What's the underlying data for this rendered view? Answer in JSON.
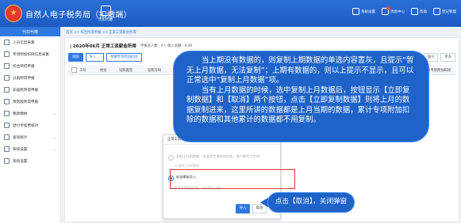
{
  "app": {
    "title": "自然人电子税务局（扣缴端）",
    "emblem": "★",
    "nav_label": "代扣代缴",
    "top_right": [
      "系统设置",
      "消息中心",
      "帮助",
      "登记管理"
    ]
  },
  "sidebar": {
    "header": "代扣代缴",
    "items": [
      {
        "label": "人员信息采集",
        "chevron": ""
      },
      {
        "label": "专项附加扣除信息采集",
        "chevron": ""
      },
      {
        "label": "综合所得申报",
        "chevron": ""
      },
      {
        "label": "分类所得申报",
        "chevron": ""
      },
      {
        "label": "非居民所得申报",
        "chevron": ""
      },
      {
        "label": "限售股所得申报",
        "chevron": ""
      },
      {
        "label": "税款缴纳",
        "chevron": "⌄"
      },
      {
        "label": "退付手续费核对",
        "chevron": ""
      },
      {
        "label": "查询统计",
        "chevron": "⌄"
      },
      {
        "label": "系统设置",
        "chevron": "⌄"
      },
      {
        "label": "系统设置",
        "chevron": ""
      }
    ]
  },
  "main": {
    "breadcrumb": "首页 >> 综合所得申报 >> 正常工资薪金所得",
    "period": "| 2020年06月 正常工资薪金所得",
    "meta": "申报总人数：0人  收入总额：0.00",
    "toolbar": [
      "添加",
      "导入 ⌄",
      "预填专项附加扣除"
    ],
    "right_tools": [
      "展开",
      "更多"
    ],
    "columns": [
      "工号",
      "姓名",
      "证照类型",
      "证照号码",
      "累计专项附加扣除"
    ]
  },
  "dialog": {
    "title": "正常工资薪金所得",
    "close": "×",
    "option1": "复制上月的数据（无此项专项附加扣除，用户需手工补充）",
    "option1_note": "◎ 复制上月的数据",
    "option2": "标准模板导入",
    "option2_note": "全部专项附加扣除，用户需手工输入",
    "confirm": "导入",
    "cancel": "取消"
  },
  "callouts": {
    "main_p1": "当上期没有数据的，则复制上期数据的单选内容置灰，且提示“暂无上月数据，无法复制”；上期有数据的，则以上提示不显示，且可以正常选中“复制上月数据”项。",
    "main_p2": "当有上月数据的时候，选中复制上月数据后，按钮显示【立即复制数据】和【取消】两个按钮，点击【立即复制数据】则将上月的数据复制进来，这里所讲的数据都是上月当期的数据，累计专项附加扣除的数据和其他累计的数据都不用复制。",
    "small": "点击【取消】，关闭弹窗"
  }
}
